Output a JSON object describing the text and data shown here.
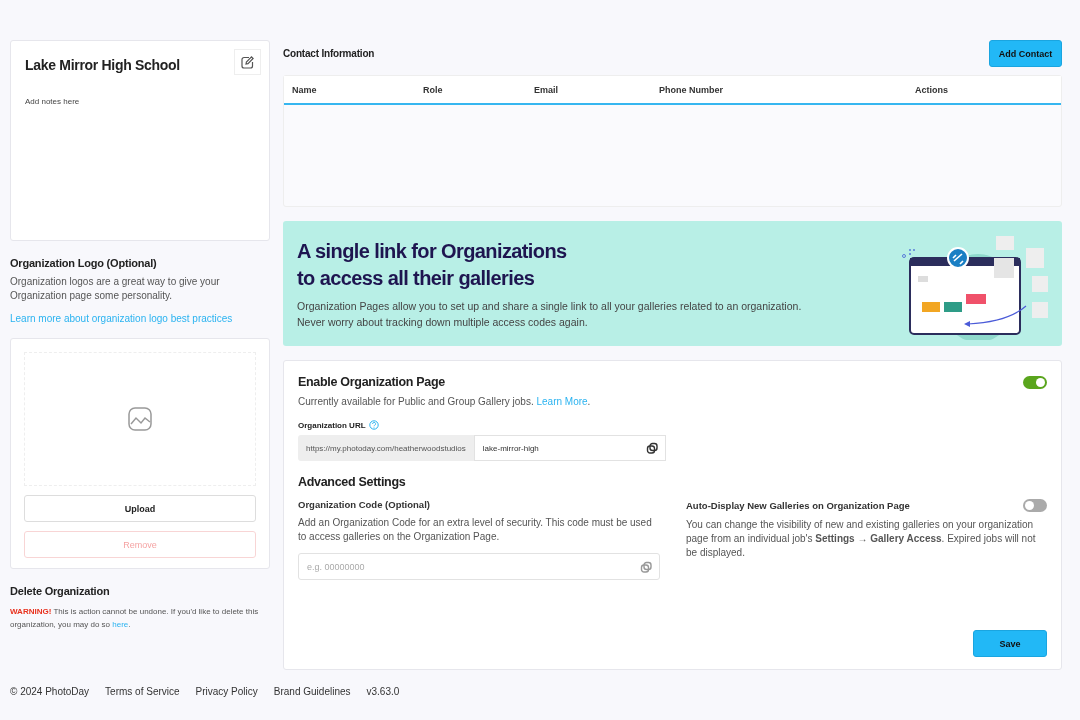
{
  "organization": {
    "name": "Lake Mirror High School",
    "notes_placeholder": "Add notes here"
  },
  "logo_section": {
    "title": "Organization Logo (Optional)",
    "description": "Organization logos are a great way to give your Organization page some personality.",
    "link": "Learn more about organization logo best practices",
    "buttons": [
      {
        "label": "Upload",
        "kind": "default",
        "disabled": false
      },
      {
        "label": "Remove",
        "kind": "danger",
        "disabled": true
      }
    ]
  },
  "delete_section": {
    "title": "Delete Organization",
    "warning_label": "WARNING!",
    "text": "This is action cannot be undone. If you'd like to delete this organization, you may do so",
    "link": "here",
    "text_end": "."
  },
  "contacts": {
    "title": "Contact Information",
    "add_button": "Add Contact",
    "columns": [
      "Name",
      "Role",
      "Email",
      "Phone Number",
      "Actions"
    ]
  },
  "banner": {
    "title_lines": [
      "A single link for Organizations",
      "to access all their galleries"
    ],
    "description_lines": [
      "Organization Pages allow you to set up and share a single link to all your galleries related to an organization.",
      "Never worry about tracking down multiple access codes again."
    ]
  },
  "org_page": {
    "title": "Enable Organization Page",
    "enabled": true,
    "availability_text": "Currently available for Public and Group Gallery jobs.",
    "learn_more": "Learn More",
    "availability_end": ".",
    "url_label": "Organization URL",
    "url_prefix": "https://my.photoday.com/heatherwoodstudios",
    "url_value": "lake-mirror-high",
    "advanced_title": "Advanced Settings",
    "code": {
      "label": "Organization Code (Optional)",
      "description": "Add an Organization Code for an extra level of security. This code must be used to access galleries on the Organization Page.",
      "placeholder": "e.g. 00000000"
    },
    "auto_display": {
      "label": "Auto-Display New Galleries on Organization Page",
      "on": false,
      "description": "You can change the visibility of new and existing galleries on your organization page from an individual job's **Settings → Gallery Access**. Expired jobs will not be displayed."
    },
    "save_button": "Save"
  },
  "footer": [
    "© 2024 PhotoDay",
    "Terms of Service",
    "Privacy Policy",
    "Brand Guidelines",
    "v3.63.0"
  ]
}
